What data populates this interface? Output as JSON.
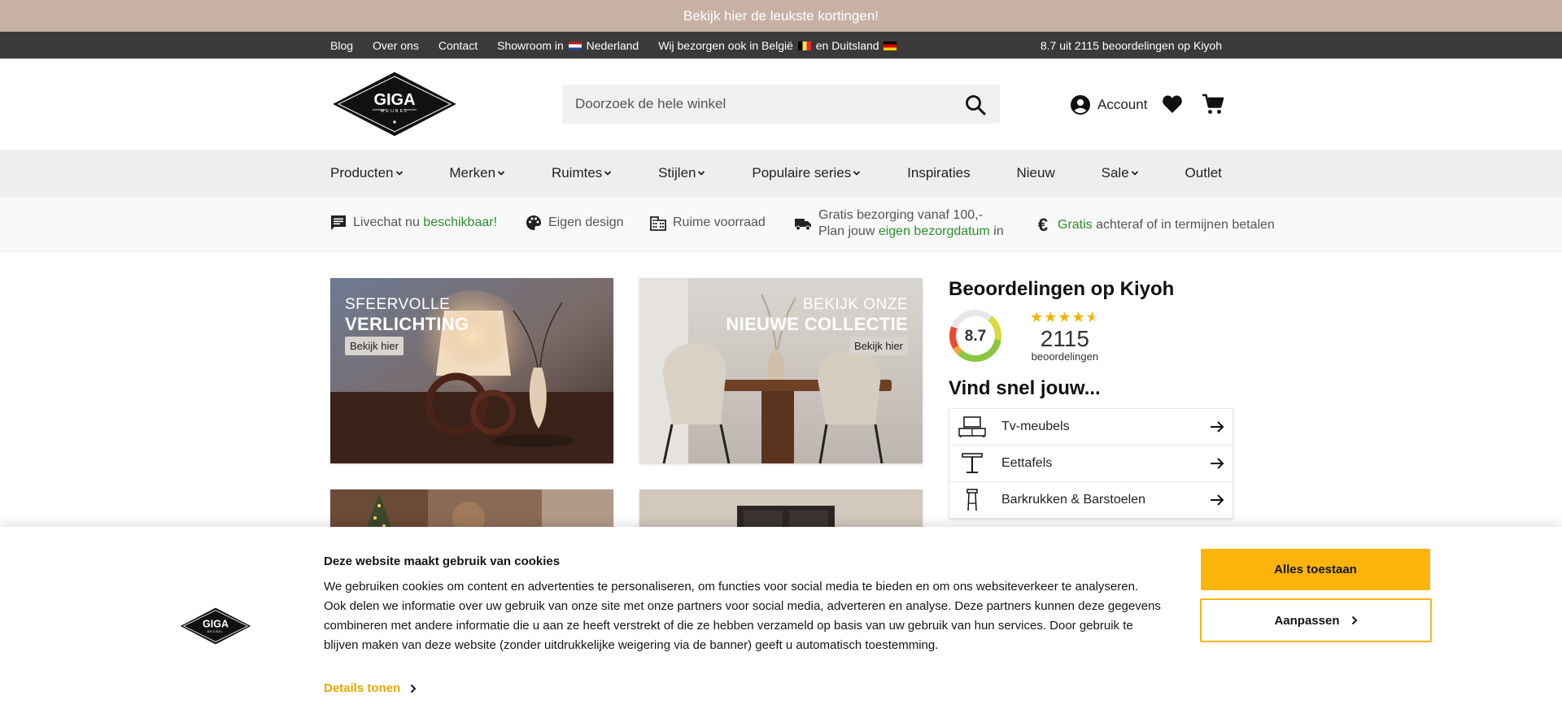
{
  "promo": {
    "text": "Bekijk hier de leukste kortingen!"
  },
  "topbar": {
    "links": [
      "Blog",
      "Over ons",
      "Contact"
    ],
    "showroom_prefix": "Showroom in",
    "showroom_country": "Nederland",
    "delivery_prefix": "Wij bezorgen ook in België",
    "delivery_and": "en Duitsland",
    "rating_text": "8.7 uit 2115 beoordelingen op Kiyoh"
  },
  "header": {
    "logo_text": "GIGA",
    "logo_sub": "MEUBEL",
    "search_placeholder": "Doorzoek de hele winkel",
    "account_label": "Account"
  },
  "nav": {
    "items": [
      {
        "label": "Producten",
        "dropdown": true
      },
      {
        "label": "Merken",
        "dropdown": true
      },
      {
        "label": "Ruimtes",
        "dropdown": true
      },
      {
        "label": "Stijlen",
        "dropdown": true
      },
      {
        "label": "Populaire series",
        "dropdown": true
      },
      {
        "label": "Inspiraties",
        "dropdown": false
      },
      {
        "label": "Nieuw",
        "dropdown": false
      },
      {
        "label": "Sale",
        "dropdown": true
      },
      {
        "label": "Outlet",
        "dropdown": false
      }
    ]
  },
  "usps": {
    "livechat_pre": "Livechat nu",
    "livechat_green": "beschikbaar!",
    "design": "Eigen design",
    "stock": "Ruime voorraad",
    "delivery_line1": "Gratis bezorging vanaf 100,-",
    "delivery_line2_pre": "Plan jouw",
    "delivery_line2_green": "eigen bezorgdatum",
    "delivery_line2_post": "in",
    "pay_green": "Gratis",
    "pay_rest": "achteraf of in termijnen betalen"
  },
  "banners": [
    {
      "line1": "SFEERVOLLE",
      "line2": "VERLICHTING",
      "button": "Bekijk hier"
    },
    {
      "line1": "BEKIJK ONZE",
      "line2": "NIEUWE COLLECTIE",
      "button": "Bekijk hier"
    }
  ],
  "reviews": {
    "title": "Beoordelingen op Kiyoh",
    "score": "8.7",
    "stars": 4.5,
    "count": "2115",
    "count_label": "beoordelingen"
  },
  "quickfind": {
    "title": "Vind snel jouw...",
    "items": [
      {
        "label": "Tv-meubels",
        "icon": "tv-furniture-icon"
      },
      {
        "label": "Eettafels",
        "icon": "dining-table-icon"
      },
      {
        "label": "Barkrukken & Barstoelen",
        "icon": "barstool-icon"
      }
    ]
  },
  "cookie": {
    "title": "Deze website maakt gebruik van cookies",
    "text": "We gebruiken cookies om content en advertenties te personaliseren, om functies voor social media te bieden en om ons websiteverkeer te analyseren. Ook delen we informatie over uw gebruik van onze site met onze partners voor social media, adverteren en analyse. Deze partners kunnen deze gegevens combineren met andere informatie die u aan ze heeft verstrekt of die ze hebben verzameld op basis van uw gebruik van hun services. Door gebruik te blijven maken van deze website (zonder uitdrukkelijke weigering via de banner) geeft u automatisch toestemming.",
    "details": "Details tonen",
    "allow": "Alles toestaan",
    "customize": "Aanpassen"
  },
  "colors": {
    "promo_bg": "#c7b1a5",
    "topbar_bg": "#3a3a3a",
    "accent_green": "#2a8f2a",
    "cookie_yellow": "#fcb40c"
  }
}
